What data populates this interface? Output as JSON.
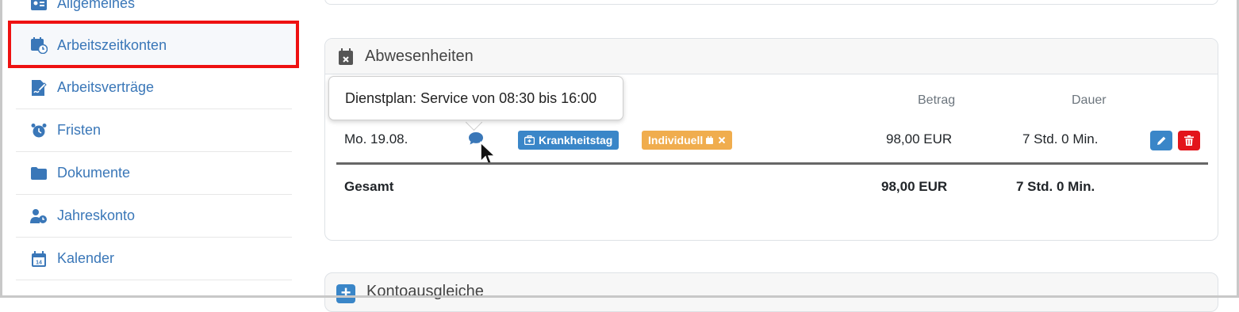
{
  "sidebar": {
    "items": [
      {
        "label": "Allgemeines",
        "icon": "id-card-icon"
      },
      {
        "label": "Arbeitszeitkonten",
        "icon": "calendar-clock-icon",
        "active": true
      },
      {
        "label": "Arbeitsverträge",
        "icon": "file-signature-icon"
      },
      {
        "label": "Fristen",
        "icon": "alarm-clock-icon"
      },
      {
        "label": "Dokumente",
        "icon": "folder-icon"
      },
      {
        "label": "Jahreskonto",
        "icon": "user-clock-icon"
      },
      {
        "label": "Kalender",
        "icon": "calendar-day-icon"
      }
    ]
  },
  "absences": {
    "title": "Abwesenheiten",
    "columns": {
      "amount": "Betrag",
      "duration": "Dauer"
    },
    "rows": [
      {
        "date": "Mo. 19.08.",
        "type_badge": "Krankheitstag",
        "mode_badge": "Individuell",
        "amount": "98,00 EUR",
        "duration": "7 Std. 0 Min."
      }
    ],
    "total": {
      "label": "Gesamt",
      "amount": "98,00 EUR",
      "duration": "7 Std. 0 Min."
    },
    "tooltip": "Dienstplan: Service von 08:30 bis 16:00"
  },
  "balancing": {
    "title": "Kontoausgleiche",
    "add_symbol": "+"
  },
  "colors": {
    "link": "#3a77b8",
    "badge_blue": "#3a86c8",
    "badge_orange": "#f0ad4e",
    "delete_red": "#e3141b",
    "highlight_red": "#ee1111"
  }
}
